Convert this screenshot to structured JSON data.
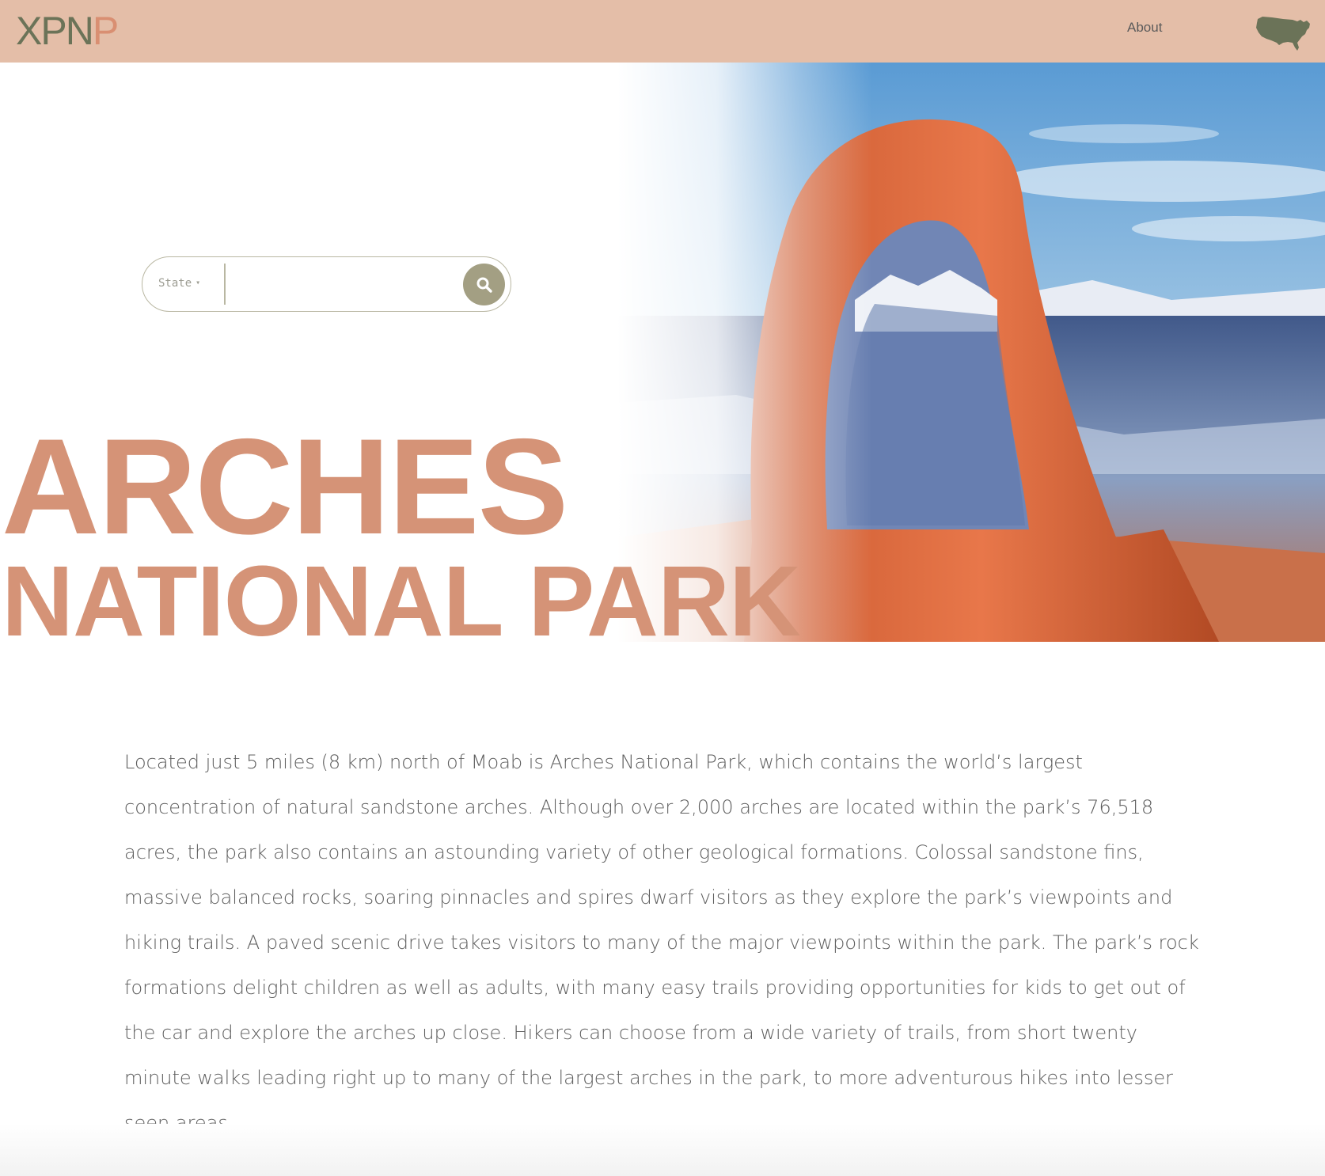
{
  "header": {
    "logo_main": "XPN",
    "logo_accent": "P",
    "nav_about": "About",
    "map_icon": "usa-map-icon"
  },
  "search": {
    "state_label": "State",
    "state_caret": "▾",
    "input_value": "",
    "input_placeholder": "",
    "button_icon": "search-icon"
  },
  "hero": {
    "title_line1": "ARCHES",
    "title_line2": "NATIONAL PARK",
    "image": "delicate-arch-photo"
  },
  "description": "Located just 5 miles (8 km) north of Moab is Arches National Park, which contains the world’s largest concentration of natural sandstone arches. Although over 2,000 arches are located within the park’s 76,518 acres, the park also contains an astounding variety of other geological formations. Colossal sandstone fins, massive balanced rocks, soaring pinnacles and spires dwarf visitors as they explore the park’s viewpoints and hiking trails. A paved scenic drive takes visitors to many of the major viewpoints within the park. The park’s rock formations delight children as well as adults, with many easy trails providing opportunities for kids to get out of the car and explore the arches up close. Hikers can choose from a wide variety of trails, from short twenty minute walks leading right up to many of the largest arches in the park, to more adventurous hikes into lesser seen areas.",
  "colors": {
    "header_bg": "#e4bea8",
    "logo_green": "#6b7358",
    "accent_salmon": "#d59377",
    "search_button": "#a39f83",
    "body_text": "#5e5e5e"
  }
}
